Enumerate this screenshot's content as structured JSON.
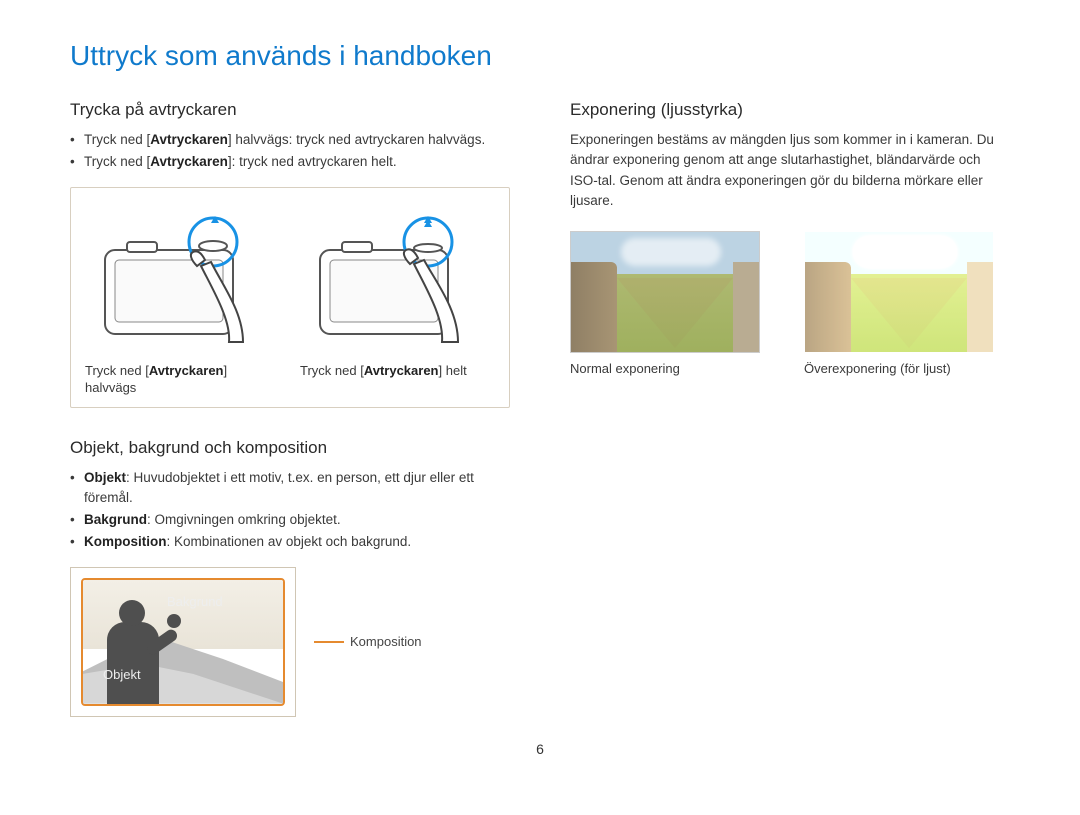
{
  "page_title": "Uttryck som används i handboken",
  "page_number": "6",
  "left": {
    "shutter": {
      "heading": "Trycka på avtryckaren",
      "bullets": [
        {
          "pre": "Tryck ned [",
          "strong": "Avtryckaren",
          "post": "] halvvägs: tryck ned avtryckaren halvvägs."
        },
        {
          "pre": "Tryck ned [",
          "strong": "Avtryckaren",
          "post": "]: tryck ned avtryckaren helt."
        }
      ],
      "cap1_pre": "Tryck ned [",
      "cap1_strong": "Avtryckaren",
      "cap1_post": "] halvvägs",
      "cap2_pre": "Tryck ned [",
      "cap2_strong": "Avtryckaren",
      "cap2_post": "] helt"
    },
    "composition": {
      "heading": "Objekt, bakgrund och komposition",
      "bullets": [
        {
          "strong": "Objekt",
          "post": ": Huvudobjektet i ett motiv, t.ex. en person, ett djur eller ett föremål."
        },
        {
          "strong": "Bakgrund",
          "post": ": Omgivningen omkring objektet."
        },
        {
          "strong": "Komposition",
          "post": ": Kombinationen av objekt och bakgrund."
        }
      ],
      "label_bakgrund": "Bakgrund",
      "label_objekt": "Objekt",
      "label_komposition": "Komposition"
    }
  },
  "right": {
    "exposure": {
      "heading": "Exponering (ljusstyrka)",
      "body": "Exponeringen bestäms av mängden ljus som kommer in i kameran. Du ändrar exponering genom att ange slutarhastighet, bländarvärde och ISO-tal. Genom att ändra exponeringen gör du bilderna mörkare eller ljusare.",
      "cap_normal": "Normal exponering",
      "cap_over": "Överexponering (för ljust)"
    }
  }
}
